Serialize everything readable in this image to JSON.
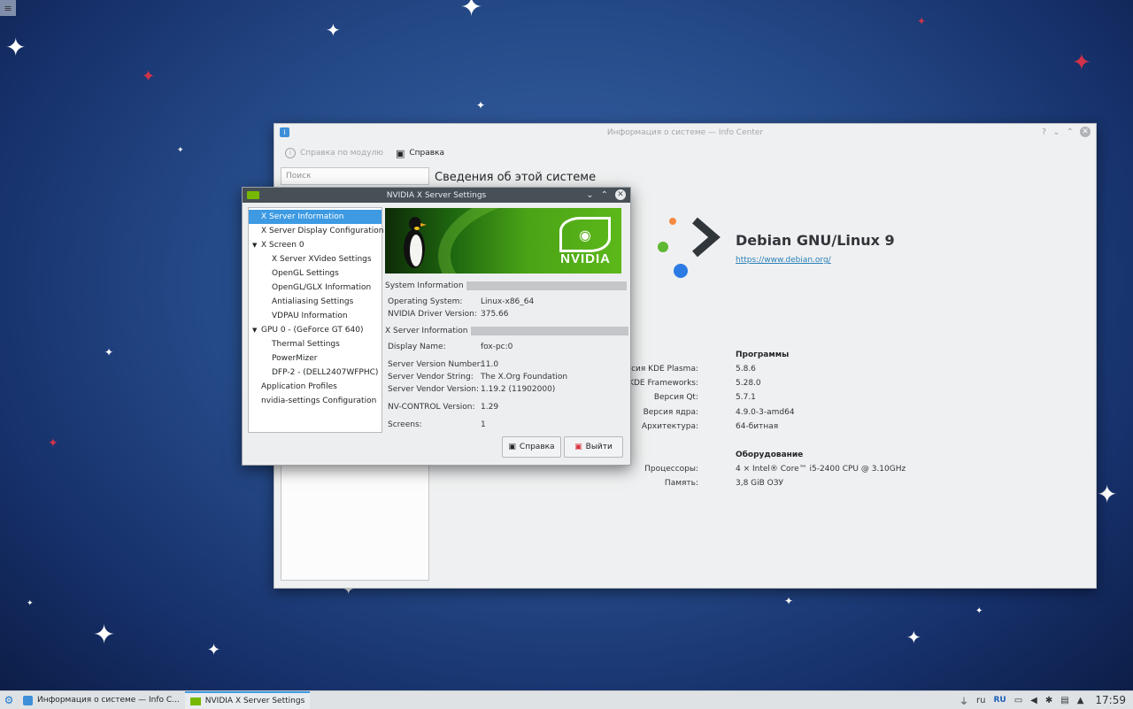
{
  "kinfo": {
    "title": "Информация о системе — Info Center",
    "toolbar": {
      "module_help": "Справка по модулю",
      "help": "Справка"
    },
    "search_placeholder": "Поиск",
    "page_heading": "Сведения об этой системе",
    "os_name": "Debian GNU/Linux 9",
    "os_url": "https://www.debian.org/",
    "software": {
      "header": "Программы",
      "rows": [
        {
          "key": "Версия KDE Plasma:",
          "value": "5.8.6"
        },
        {
          "key": "Версия KDE Frameworks:",
          "value": "5.28.0"
        },
        {
          "key": "Версия Qt:",
          "value": "5.7.1"
        },
        {
          "key": "Версия ядра:",
          "value": "4.9.0-3-amd64"
        },
        {
          "key": "Архитектура:",
          "value": "64-битная"
        }
      ]
    },
    "hardware": {
      "header": "Оборудование",
      "rows": [
        {
          "key": "Процессоры:",
          "value": "4 × Intel® Core™ i5-2400 CPU @ 3.10GHz"
        },
        {
          "key": "Память:",
          "value": "3,8 GiB ОЗУ"
        }
      ]
    }
  },
  "nvidia": {
    "title": "NVIDIA X Server Settings",
    "tree": [
      {
        "label": "X Server Information"
      },
      {
        "label": "X Server Display Configuration"
      },
      {
        "label": "X Screen 0"
      },
      {
        "label": "X Server XVideo Settings"
      },
      {
        "label": "OpenGL Settings"
      },
      {
        "label": "OpenGL/GLX Information"
      },
      {
        "label": "Antialiasing Settings"
      },
      {
        "label": "VDPAU Information"
      },
      {
        "label": "GPU 0 - (GeForce GT 640)"
      },
      {
        "label": "Thermal Settings"
      },
      {
        "label": "PowerMizer"
      },
      {
        "label": "DFP-2 - (DELL2407WFPHC)"
      },
      {
        "label": "Application Profiles"
      },
      {
        "label": "nvidia-settings Configuration"
      }
    ],
    "banner_word": "NVIDIA",
    "system_info": {
      "header": "System Information",
      "rows": [
        {
          "key": "Operating System:",
          "value": "Linux-x86_64"
        },
        {
          "key": "NVIDIA Driver Version:",
          "value": "375.66"
        }
      ]
    },
    "xserver_info": {
      "header": "X Server Information",
      "rows": [
        {
          "key": "Display Name:",
          "value": "fox-pc:0"
        },
        {
          "key": "Server Version Number:",
          "value": "11.0"
        },
        {
          "key": "Server Vendor String:",
          "value": "The X.Org Foundation"
        },
        {
          "key": "Server Vendor Version:",
          "value": "1.19.2 (11902000)"
        },
        {
          "key": "NV-CONTROL Version:",
          "value": "1.29"
        },
        {
          "key": "Screens:",
          "value": "1"
        }
      ]
    },
    "buttons": {
      "help": "Справка",
      "quit": "Выйти"
    }
  },
  "taskbar": {
    "tasks": [
      {
        "label": "Информация о системе — Info C..."
      },
      {
        "label": "NVIDIA X Server Settings"
      }
    ],
    "tray": {
      "lang": "ru",
      "lang_flag": "RU",
      "clock": "17:59"
    }
  },
  "colors": {
    "accent": "#3d9ae3",
    "nvidia_green": "#76b900",
    "desktop": "#254a88"
  }
}
